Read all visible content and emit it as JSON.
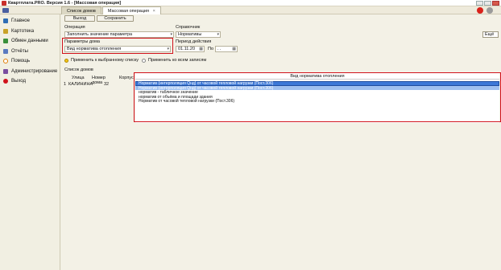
{
  "window": {
    "title": "Квартплата.PRO. Версия 1.6 - [Массовая операция]"
  },
  "tabs": [
    {
      "label": "Список домов",
      "active": false
    },
    {
      "label": "Массовая операция",
      "active": true,
      "close": "×"
    }
  ],
  "sidebar": {
    "items": [
      {
        "label": "Главное",
        "icon": "home-icon",
        "color": "#2e6db4"
      },
      {
        "label": "Картотека",
        "icon": "folder-icon",
        "color": "#c9a227"
      },
      {
        "label": "Обмен данными",
        "icon": "exchange-icon",
        "color": "#3a8f3a"
      },
      {
        "label": "Отчёты",
        "icon": "report-icon",
        "color": "#5a7ac0"
      },
      {
        "label": "Помощь",
        "icon": "help-icon",
        "color": "#e07b00"
      },
      {
        "label": "Администрирование",
        "icon": "admin-icon",
        "color": "#7a4fa0"
      },
      {
        "label": "Выход",
        "icon": "exit-icon",
        "color": "#d0121b"
      }
    ]
  },
  "toolbar": {
    "exit_label": "Выход",
    "save_label": "Сохранить"
  },
  "form": {
    "operation_label": "Операция",
    "operation_value": "Заполнить значение параметра",
    "reference_label": "Справочник",
    "reference_value": "Нормативы",
    "more_label": "Ещё",
    "params_label": "Параметры дома",
    "params_value": "Вид норматива отопления",
    "period_label": "Период действия",
    "period_from": "01.11.20",
    "period_to_label": "По",
    "period_to": ". .",
    "radio_selected": "Применить к выбранному списку",
    "radio_all": "Применить ко всем записям"
  },
  "houses": {
    "section_label": "Список домов",
    "columns": [
      "Улица",
      "Номер дома",
      "Корпус"
    ],
    "rows": [
      {
        "marker": "1",
        "street": "КАЛИНИНА",
        "number": "32"
      }
    ]
  },
  "dropdown": {
    "header": "Вид норматива отопления",
    "options": [
      "Норматив (интерполяция Qнд) от часовой тепловой нагрузки (Пост.306)",
      "Норматив (интерполяция Qнд) от часовой тепловой нагрузки (Пост.306)",
      "норматив - табличное значение",
      "норматив от объёма и площади здания",
      "Норматив от часовой тепловой нагрузки (Пост.306)"
    ]
  }
}
